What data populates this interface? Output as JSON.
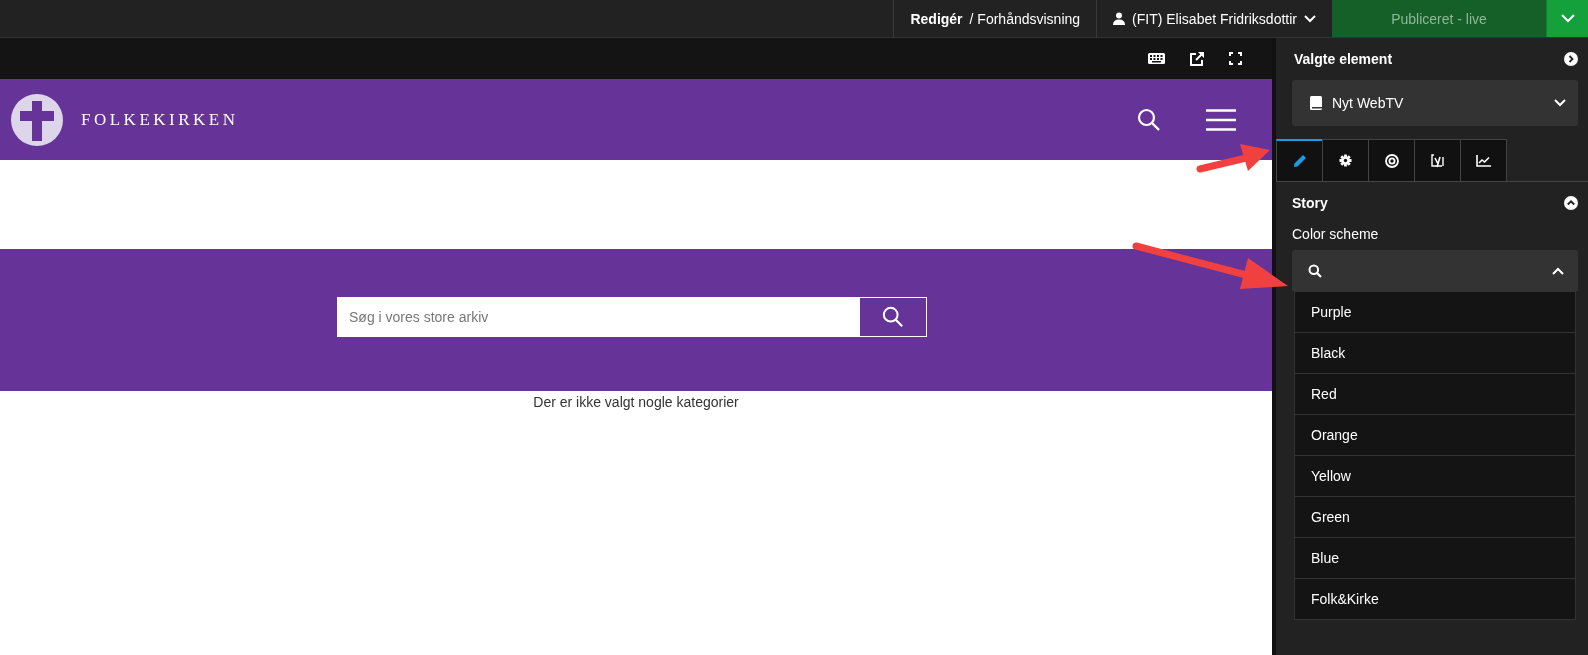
{
  "top_bar": {
    "mode": "**Redigér** / Forhåndsvisning",
    "user": "(FIT) Elisabet Fridriksdottir",
    "publish": "Publiceret - live"
  },
  "preview": {
    "brand": "FOLKEKIRKEN",
    "search": {
      "placeholder": "Søg i vores store arkiv"
    },
    "message": "Der er ikke valgt nogle kategorier"
  },
  "panel": {
    "title": "Valgte element",
    "element": "Nyt WebTV",
    "tabs": [
      {
        "kind": "pencil",
        "selected": true
      },
      {
        "kind": "gear",
        "selected": false
      },
      {
        "kind": "target",
        "selected": false
      },
      {
        "kind": "yoast",
        "selected": false
      },
      {
        "kind": "chart",
        "selected": false
      }
    ],
    "section": {
      "title": "Story",
      "expanded": true,
      "field_label": "Color scheme",
      "dropdown_open": true,
      "options": [
        "Purple",
        "Black",
        "Red",
        "Orange",
        "Yellow",
        "Green",
        "Blue",
        "Folk&Kirke"
      ]
    }
  }
}
